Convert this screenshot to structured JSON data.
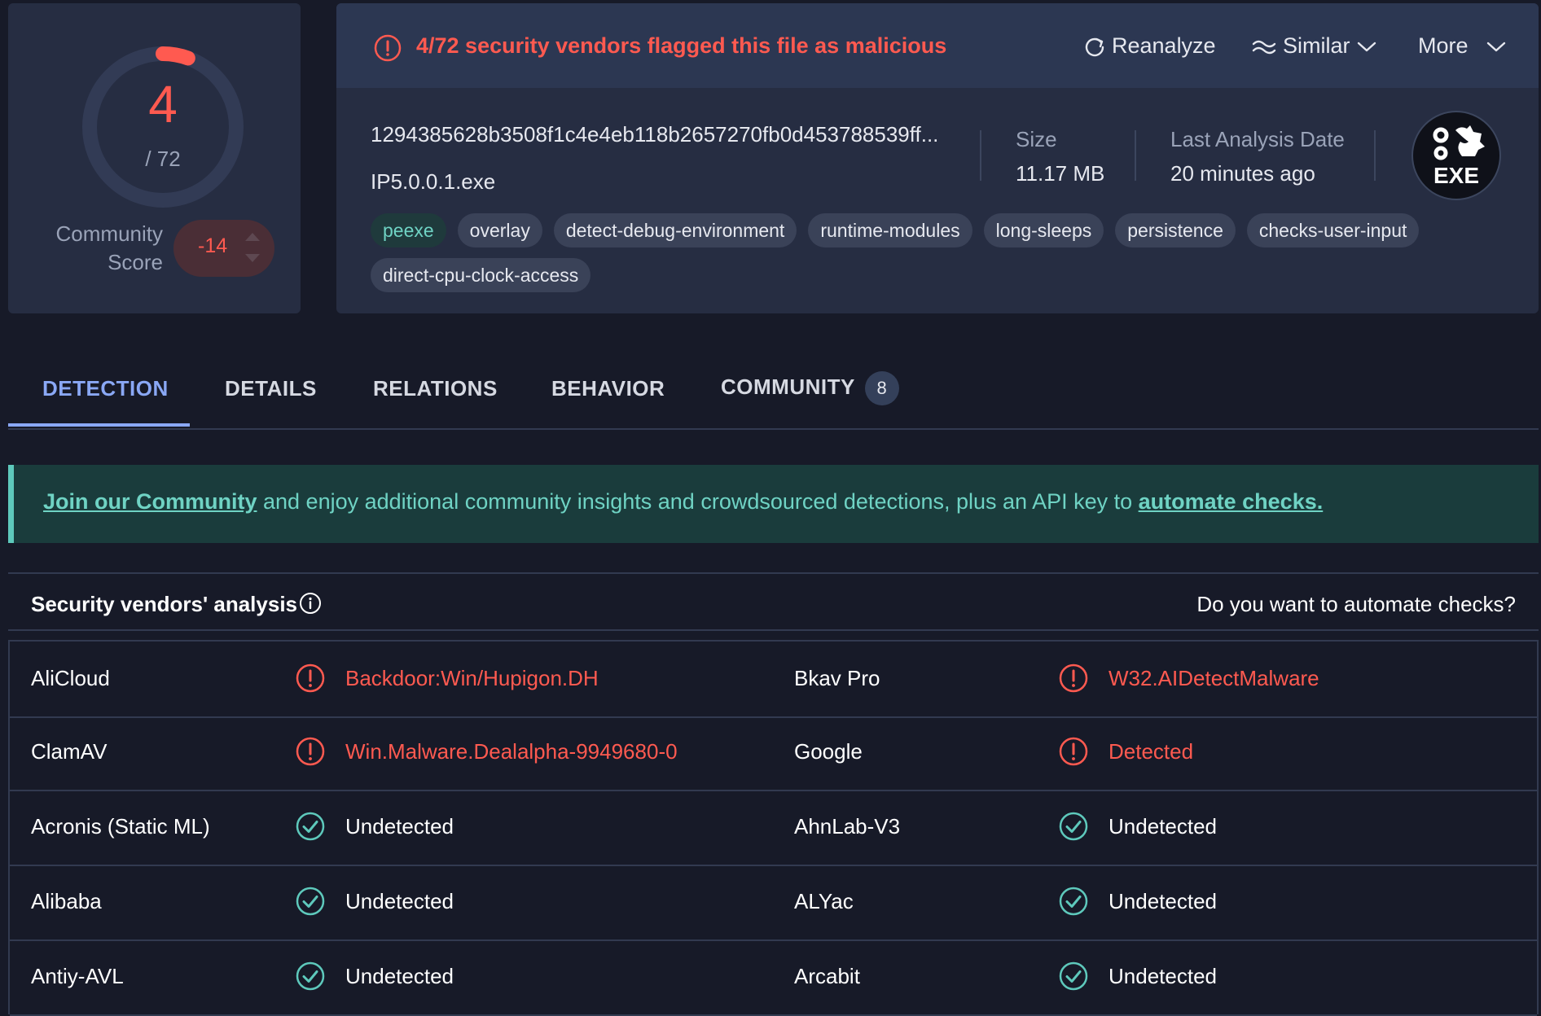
{
  "score": {
    "detections": "4",
    "total": "/ 72",
    "detection_fraction": 0.0556,
    "community_label_line1": "Community",
    "community_label_line2": "Score",
    "community_score": "-14"
  },
  "alert": {
    "text": "4/72 security vendors flagged this file as malicious",
    "actions": {
      "reanalyze": "Reanalyze",
      "similar": "Similar",
      "more": "More"
    }
  },
  "file": {
    "hash": "1294385628b3508f1c4e4eb118b2657270fb0d453788539ff...",
    "name": "IP5.0.0.1.exe",
    "size_label": "Size",
    "size_value": "11.17 MB",
    "date_label": "Last Analysis Date",
    "date_value": "20 minutes ago",
    "type_badge": "EXE",
    "tags": [
      "peexe",
      "overlay",
      "detect-debug-environment",
      "runtime-modules",
      "long-sleeps",
      "persistence",
      "checks-user-input",
      "direct-cpu-clock-access"
    ]
  },
  "tabs": {
    "detection": "DETECTION",
    "details": "DETAILS",
    "relations": "RELATIONS",
    "behavior": "BEHAVIOR",
    "community": "COMMUNITY",
    "community_count": "8"
  },
  "banner": {
    "link1": "Join our Community",
    "middle": " and enjoy additional community insights and crowdsourced detections, plus an API key to ",
    "link2": "automate checks."
  },
  "vendors_section": {
    "title": "Security vendors' analysis",
    "automate": "Do you want to automate checks?"
  },
  "vendors": [
    [
      {
        "name": "AliCloud",
        "result": "Backdoor:Win/Hupigon.DH",
        "status": "malicious"
      },
      {
        "name": "Bkav Pro",
        "result": "W32.AIDetectMalware",
        "status": "malicious"
      }
    ],
    [
      {
        "name": "ClamAV",
        "result": "Win.Malware.Dealalpha-9949680-0",
        "status": "malicious"
      },
      {
        "name": "Google",
        "result": "Detected",
        "status": "malicious"
      }
    ],
    [
      {
        "name": "Acronis (Static ML)",
        "result": "Undetected",
        "status": "clean"
      },
      {
        "name": "AhnLab-V3",
        "result": "Undetected",
        "status": "clean"
      }
    ],
    [
      {
        "name": "Alibaba",
        "result": "Undetected",
        "status": "clean"
      },
      {
        "name": "ALYac",
        "result": "Undetected",
        "status": "clean"
      }
    ],
    [
      {
        "name": "Antiy-AVL",
        "result": "Undetected",
        "status": "clean"
      },
      {
        "name": "Arcabit",
        "result": "Undetected",
        "status": "clean"
      }
    ]
  ],
  "colors": {
    "malicious": "#ff5a50",
    "clean": "#5ec9bc",
    "accent": "#8aa8f5"
  },
  "icons": {
    "malicious": "alert-circle-icon",
    "clean": "check-circle-icon",
    "reanalyze": "refresh-icon",
    "similar": "similar-icon",
    "chevron": "chevron-down-icon",
    "info": "info-icon",
    "file_type": "exe-file-icon"
  }
}
